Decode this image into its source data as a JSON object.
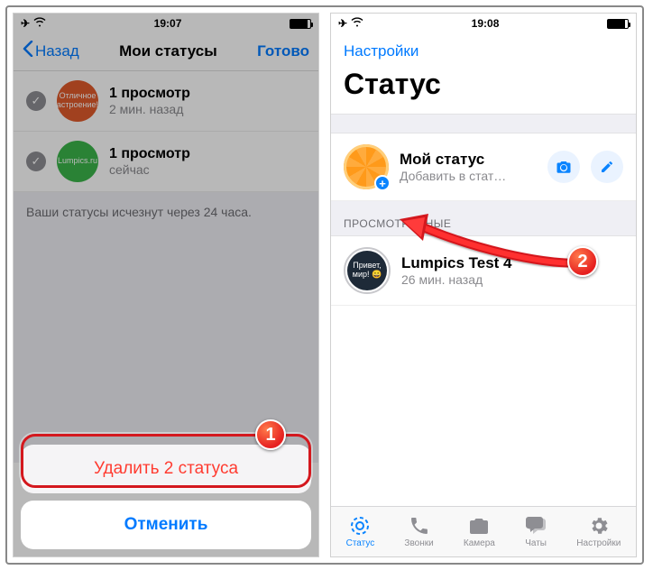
{
  "left": {
    "statusbar": {
      "time": "19:07"
    },
    "nav": {
      "back": "Назад",
      "title": "Мои статусы",
      "done": "Готово"
    },
    "items": [
      {
        "avatar_text": "Отличное настроение!!!",
        "title": "1 просмотр",
        "subtitle": "2 мин. назад"
      },
      {
        "avatar_text": "Lumpics.ru",
        "title": "1 просмотр",
        "subtitle": "сейчас"
      }
    ],
    "footer_note": "Ваши статусы исчезнут через 24 часа.",
    "sheet": {
      "delete": "Удалить 2 статуса",
      "cancel": "Отменить"
    }
  },
  "right": {
    "statusbar": {
      "time": "19:08"
    },
    "settings_link": "Настройки",
    "big_title": "Статус",
    "my_status": {
      "title": "Мой статус",
      "subtitle": "Добавить в стат…"
    },
    "section_label": "ПРОСМОТРЕННЫЕ",
    "viewed": {
      "avatar_text": "Привет, мир! 😀",
      "title": "Lumpics Test 4",
      "subtitle": "26 мин. назад"
    },
    "tabs": {
      "status": "Статус",
      "calls": "Звонки",
      "camera": "Камера",
      "chats": "Чаты",
      "settings": "Настройки"
    }
  },
  "markers": {
    "one": "1",
    "two": "2"
  }
}
